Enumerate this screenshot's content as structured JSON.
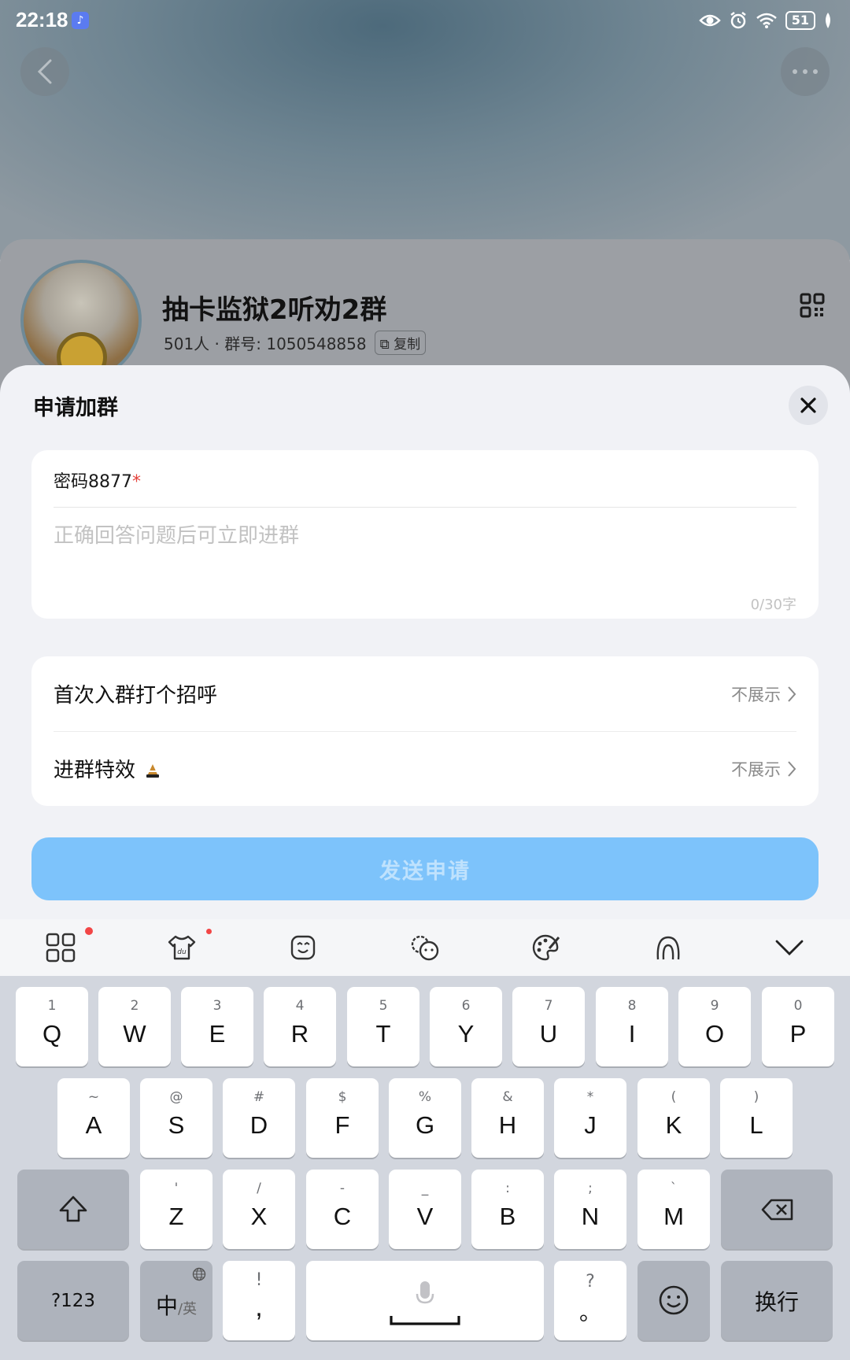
{
  "status_bar": {
    "time": "22:18",
    "battery": "51"
  },
  "group": {
    "name": "抽卡监狱2听劝2群",
    "meta": "501人 · 群号: 1050548858",
    "copy_label": "复制"
  },
  "sheet": {
    "title": "申请加群",
    "question_label": "密码8877",
    "required_mark": "*",
    "answer_placeholder": "正确回答问题后可立即进群",
    "char_count": "0/30字",
    "options": [
      {
        "label": "首次入群打个招呼",
        "value": "不展示"
      },
      {
        "label": "进群特效",
        "value": "不展示"
      }
    ],
    "send_label": "发送申请"
  },
  "keyboard": {
    "toolbar": [
      "apps-icon",
      "skin-icon",
      "sticker-icon",
      "emoji-face-icon",
      "palette-icon",
      "gesture-icon",
      "collapse-icon"
    ],
    "row1": [
      {
        "sub": "1",
        "main": "Q"
      },
      {
        "sub": "2",
        "main": "W"
      },
      {
        "sub": "3",
        "main": "E"
      },
      {
        "sub": "4",
        "main": "R"
      },
      {
        "sub": "5",
        "main": "T"
      },
      {
        "sub": "6",
        "main": "Y"
      },
      {
        "sub": "7",
        "main": "U"
      },
      {
        "sub": "8",
        "main": "I"
      },
      {
        "sub": "9",
        "main": "O"
      },
      {
        "sub": "0",
        "main": "P"
      }
    ],
    "row2": [
      {
        "sub": "~",
        "main": "A"
      },
      {
        "sub": "@",
        "main": "S"
      },
      {
        "sub": "#",
        "main": "D"
      },
      {
        "sub": "$",
        "main": "F"
      },
      {
        "sub": "%",
        "main": "G"
      },
      {
        "sub": "&",
        "main": "H"
      },
      {
        "sub": "*",
        "main": "J"
      },
      {
        "sub": "(",
        "main": "K"
      },
      {
        "sub": ")",
        "main": "L"
      }
    ],
    "row3": [
      {
        "sub": "'",
        "main": "Z"
      },
      {
        "sub": "/",
        "main": "X"
      },
      {
        "sub": "-",
        "main": "C"
      },
      {
        "sub": "_",
        "main": "V"
      },
      {
        "sub": ":",
        "main": "B"
      },
      {
        "sub": ";",
        "main": "N"
      },
      {
        "sub": "`",
        "main": "M"
      }
    ],
    "num_switch": "?123",
    "lang_main": "中",
    "lang_sub": "/英",
    "comma_sub": "!",
    "comma_main": ",",
    "period_sub": "?",
    "period_main": "。",
    "enter_label": "换行"
  }
}
